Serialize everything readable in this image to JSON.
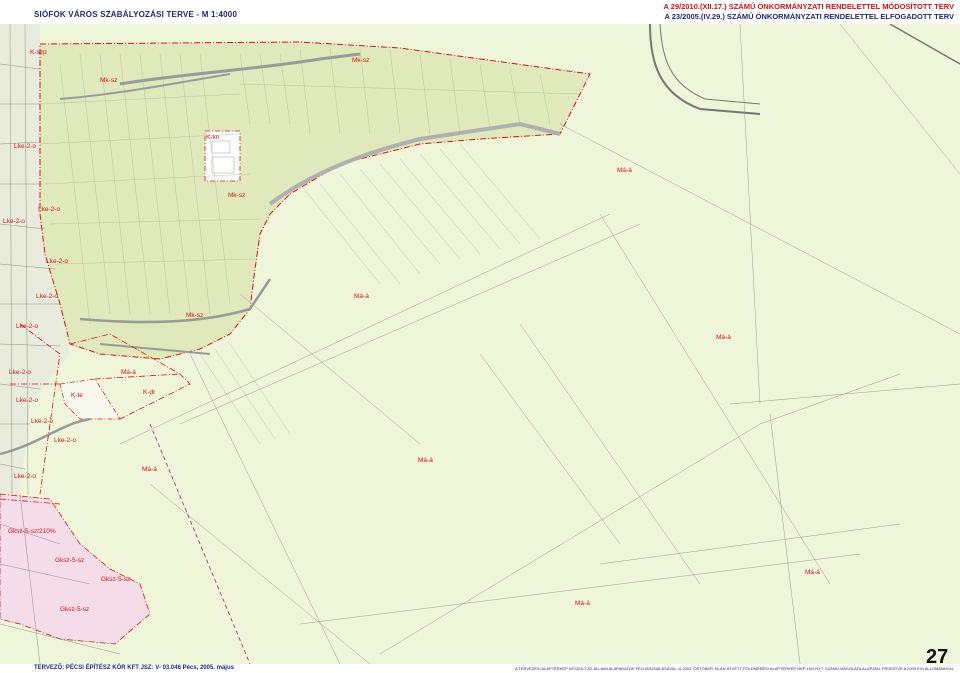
{
  "header": {
    "title_left": "SIÓFOK VÁROS SZABÁLYOZÁSI TERVE  -  M 1:4000",
    "title_right_1": "A 29/2010.(XII.17.) SZÁMÚ ÖNKORMÁNYZATI RENDELETTEL MÓDOSÍTOTT TERV",
    "title_right_2": "A 23/2005.(IV.29.) SZÁMÚ ÖNKORMÁNYZATI RENDELETTEL ELFOGADOTT TERV"
  },
  "labels": {
    "k_szp": "K-szp",
    "mk_sz_1": "Mk-sz",
    "mk_sz_2": "Mk-sz",
    "mk_sz_3": "Mk-sz",
    "mk_sz_4": "Mk-sz",
    "k_kn": "K-kn",
    "lke2o_1": "Lke-2-o",
    "lke2o_2": "Lke-2-o",
    "lke2o_3": "Lke-2-o",
    "lke2o_4": "Lke-2-o",
    "lke2o_5": "Lke-2-o",
    "lke2o_6": "Lke-2-o",
    "lke2o_7": "Lke-2-o",
    "lke2o_8": "Lke-2-o",
    "lke2o_9": "Lke-2-o",
    "lke2o_10": "Lke-2-o",
    "lke2o_11": "Lke-2-o",
    "ma_a_1": "Má-á",
    "ma_a_2": "Má-á",
    "ma_a_3": "Má-á",
    "ma_a_4": "Má-á",
    "ma_a_5": "Má-á",
    "ma_a_6": "Má-á",
    "ma_a_7": "Má-á",
    "ma_a_8": "Má-á",
    "k_te": "K-te",
    "k_dr": "K-dr",
    "gksz_1": "Gksz-5-sz/210%",
    "gksz_2": "Gksz-5-sz",
    "gksz_3": "Gksz-5-sz",
    "gksz_4": "Gksz-5-sz"
  },
  "footer": {
    "left": "TERVEZŐ: PÉCSI ÉPÍTÉSZ KÖR KFT  JSZ: V- 03.046  Pécs, 2005. május",
    "right": "A TERVEZÉSI ALAPTÉRKÉP KÉSZÜLT AZ ÁLLAMI ALAPADATOK FELHASZNÁLÁSÁVAL, A 2003. OKTÓBER 16-ÁN ÁTVETT FÖLDMÉRÉSI ALAPTÉRKÉP NKP 15/4 NYT. SZÁMÚ MÁSOLATA ALAPJÁN, FRISSÍTVE A 2009 ÉVI ÁLLOMÁNNYAL",
    "page_number": "27"
  },
  "colors": {
    "agri_fill": "#eef5d8",
    "village_fill": "#dfe9bb",
    "urban_fill": "#e9ecdc",
    "gksz_fill": "#f4dce8",
    "boundary_red": "#d41414",
    "road_grey": "#9a9a9a",
    "title_blue": "#1e2a78"
  }
}
